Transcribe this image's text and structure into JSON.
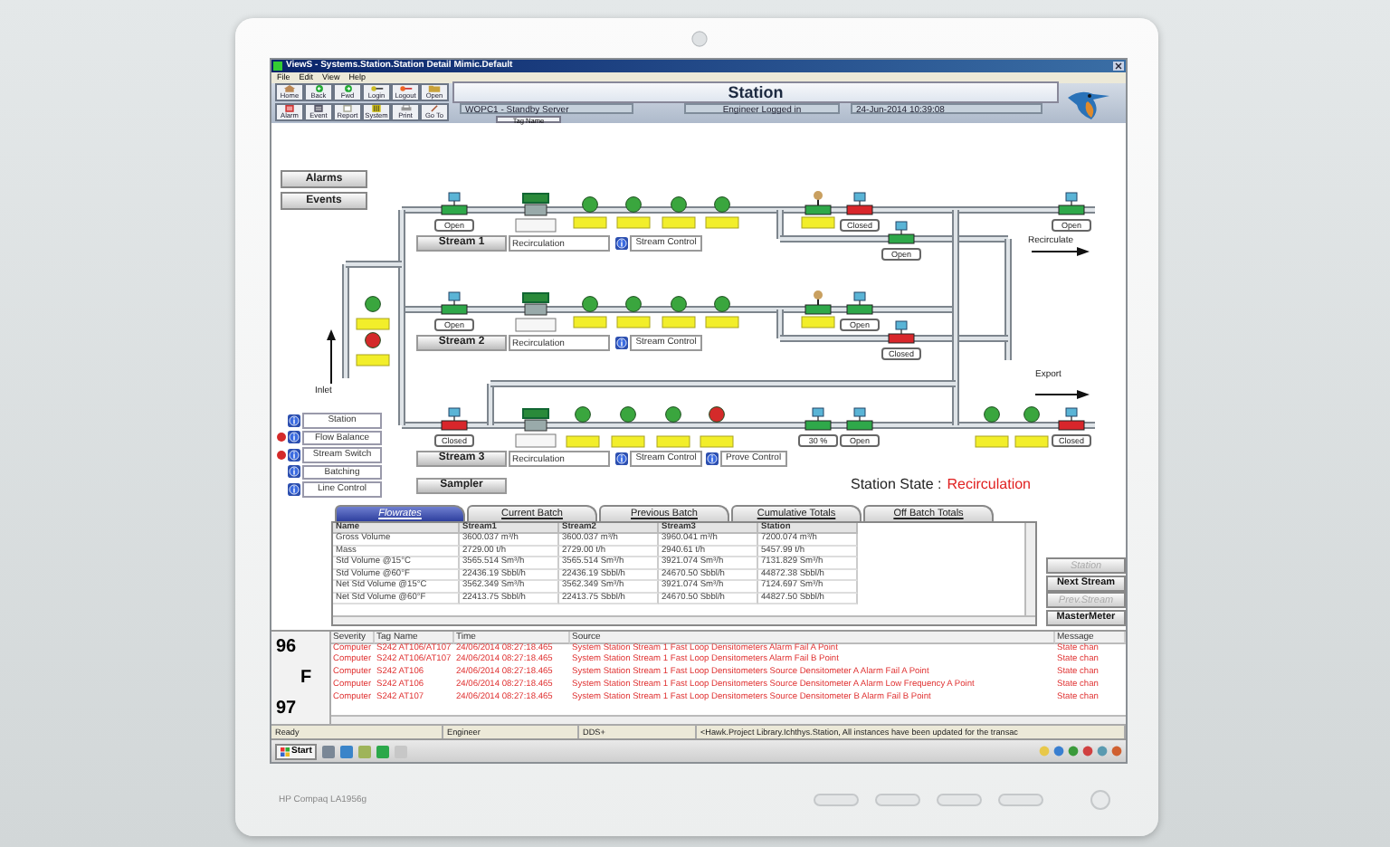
{
  "window": {
    "title": "ViewS - Systems.Station.Station Detail Mimic.Default"
  },
  "menu": [
    "File",
    "Edit",
    "View",
    "Help"
  ],
  "toolbar": [
    {
      "label": "Home",
      "kind": "home"
    },
    {
      "label": "Back",
      "kind": "back"
    },
    {
      "label": "Fwd",
      "kind": "forward"
    },
    {
      "label": "Login",
      "kind": "login"
    },
    {
      "label": "Logout",
      "kind": "logout"
    },
    {
      "label": "Open",
      "kind": "open"
    },
    {
      "label": "Alarm",
      "kind": "alarm"
    },
    {
      "label": "Event",
      "kind": "event"
    },
    {
      "label": "Report",
      "kind": "report"
    },
    {
      "label": "System",
      "kind": "system"
    },
    {
      "label": "Print",
      "kind": "print"
    },
    {
      "label": "Go To",
      "kind": "goto"
    }
  ],
  "header": {
    "title": "Station",
    "server": "WOPC1 - Standby Server",
    "user": "Engineer Logged in",
    "datetime": "24-Jun-2014 10:39:08",
    "tag_button": "Tag Name"
  },
  "mimic": {
    "buttons": [
      "Alarms",
      "Events"
    ],
    "streams": [
      {
        "label": "Stream 1",
        "mode": "Recirculation",
        "control": "Stream Control"
      },
      {
        "label": "Stream 2",
        "mode": "Recirculation",
        "control": "Stream Control"
      },
      {
        "label": "Stream 3",
        "mode": "Recirculation",
        "control": "Stream Control",
        "prove": "Prove Control"
      }
    ],
    "sampler": "Sampler",
    "valves": [
      {
        "label": "Open",
        "closed": false
      },
      {
        "label": "Closed",
        "closed": true
      },
      {
        "label": "Open",
        "closed": false
      },
      {
        "label": "Open",
        "closed": false
      },
      {
        "label": "Open",
        "closed": false
      },
      {
        "label": "Open",
        "closed": false
      },
      {
        "label": "Closed",
        "closed": true
      },
      {
        "label": "Closed",
        "closed": true
      },
      {
        "label": "30 %",
        "closed": false
      },
      {
        "label": "Open",
        "closed": false
      },
      {
        "label": "Closed",
        "closed": true
      }
    ],
    "flow_labels": [
      {
        "label": "Inlet",
        "kind": "inlet"
      },
      {
        "label": "Recirculate",
        "kind": "recirculate"
      },
      {
        "label": "Export",
        "kind": "export"
      }
    ],
    "nav": [
      {
        "label": "Station",
        "alarm": false
      },
      {
        "label": "Flow Balance",
        "alarm": true
      },
      {
        "label": "Stream Switch",
        "alarm": true
      },
      {
        "label": "Batching",
        "alarm": false
      },
      {
        "label": "Line Control",
        "alarm": false
      }
    ],
    "station_state": {
      "label": "Station State :",
      "value": "Recirculation"
    }
  },
  "flow_table": {
    "tabs": [
      {
        "label": "Flowrates",
        "selected": true
      },
      {
        "label": "Current Batch",
        "selected": false
      },
      {
        "label": "Previous Batch",
        "selected": false
      },
      {
        "label": "Cumulative Totals",
        "selected": false
      },
      {
        "label": "Off Batch Totals",
        "selected": false
      }
    ],
    "columns": [
      "Name",
      "Stream1",
      "Stream2",
      "Stream3",
      "Station"
    ],
    "rows": [
      [
        "Gross Volume",
        "3600.037 m³/h",
        "3600.037 m³/h",
        "3960.041 m³/h",
        "7200.074 m³/h"
      ],
      [
        "Mass",
        "2729.00 t/h",
        "2729.00 t/h",
        "2940.61 t/h",
        "5457.99 t/h"
      ],
      [
        "Std Volume @15°C",
        "3565.514 Sm³/h",
        "3565.514 Sm³/h",
        "3921.074 Sm³/h",
        "7131.829 Sm³/h"
      ],
      [
        "Std Volume @60°F",
        "22436.19 Sbbl/h",
        "22436.19 Sbbl/h",
        "24670.50 Sbbl/h",
        "44872.38 Sbbl/h"
      ],
      [
        "Net Std Volume @15°C",
        "3562.349 Sm³/h",
        "3562.349 Sm³/h",
        "3921.074 Sm³/h",
        "7124.697 Sm³/h"
      ],
      [
        "Net Std Volume @60°F",
        "22413.75 Sbbl/h",
        "22413.75 Sbbl/h",
        "24670.50 Sbbl/h",
        "44827.50 Sbbl/h"
      ]
    ]
  },
  "stream_buttons": [
    {
      "label": "Station",
      "disabled": true
    },
    {
      "label": "Next Stream",
      "disabled": false
    },
    {
      "label": "Prev.Stream",
      "disabled": true
    },
    {
      "label": "MasterMeter",
      "disabled": false
    }
  ],
  "alarm_log": {
    "counter": {
      "high": "96",
      "unit": "F",
      "low": "97"
    },
    "columns": [
      "Severity",
      "Tag Name",
      "Time",
      "Source",
      "Message"
    ],
    "rows": [
      [
        "Computer",
        "S242 AT106/AT107",
        "24/06/2014 08:27:18.465",
        "System Station Stream 1 Fast Loop Densitometers Alarm Fail A Point",
        "State chan"
      ],
      [
        "Computer",
        "S242 AT106/AT107",
        "24/06/2014 08:27:18.465",
        "System Station Stream 1 Fast Loop Densitometers Alarm Fail B Point",
        "State chan"
      ],
      [
        "Computer",
        "S242 AT106",
        "24/06/2014 08:27:18.465",
        "System Station Stream 1 Fast Loop Densitometers Source Densitometer A Alarm Fail A Point",
        "State chan"
      ],
      [
        "Computer",
        "S242 AT106",
        "24/06/2014 08:27:18.465",
        "System Station Stream 1 Fast Loop Densitometers Source Densitometer A Alarm Low Frequency A Point",
        "State chan"
      ],
      [
        "Computer",
        "S242 AT107",
        "24/06/2014 08:27:18.465",
        "System Station Stream 1 Fast Loop Densitometers Source Densitometer B Alarm Fail B Point",
        "State chan"
      ]
    ]
  },
  "status_bar": [
    "Ready",
    "Engineer",
    "DDS+",
    "<Hawk.Project Library.Ichthys.Station, All instances have been updated for the transac"
  ],
  "taskbar": {
    "start": "Start"
  },
  "monitor": {
    "brand": "HP Compaq LA1956g"
  }
}
